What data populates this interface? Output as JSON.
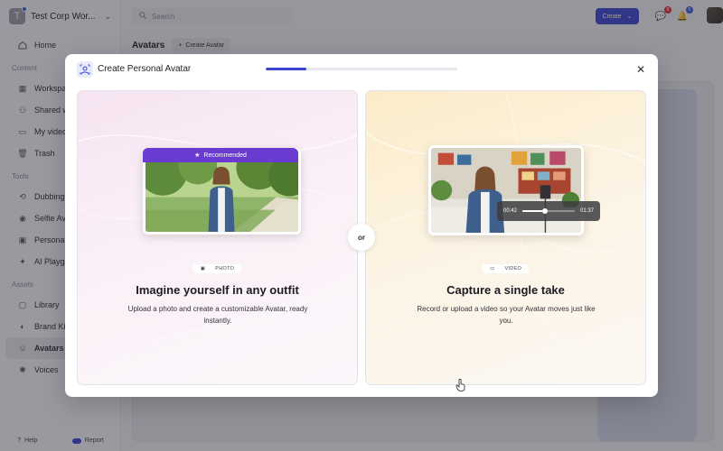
{
  "workspace": {
    "initial": "T",
    "name": "Test Corp Wor..."
  },
  "nav": {
    "home": "Home",
    "content_section": "Content",
    "content_items": [
      "Workspace",
      "Shared with",
      "My videos",
      "Trash"
    ],
    "tools_section": "Tools",
    "tools_items": [
      "Dubbing",
      "Selfie Avata",
      "Personaliza",
      "AI Playgrou"
    ],
    "assets_section": "Assets",
    "assets_items": [
      "Library",
      "Brand Kits",
      "Avatars",
      "Voices"
    ],
    "help": "Help",
    "report": "Report"
  },
  "topbar": {
    "search_placeholder": "Search",
    "create_label": "Create",
    "messages_count": "8",
    "notifications_count": "5"
  },
  "page": {
    "title": "Avatars",
    "create_avatar_label": "Create Avatar"
  },
  "modal": {
    "title": "Create Personal Avatar",
    "progress": 0.21,
    "or_label": "or",
    "photo": {
      "badge": "Recommended",
      "kind": "PHOTO",
      "title": "Imagine yourself in any outfit",
      "desc": "Upload a photo and create a customizable Avatar, ready instantly."
    },
    "video": {
      "kind": "VIDEO",
      "title": "Capture a single take",
      "desc": "Record or upload a video so your Avatar moves just like you.",
      "time_current": "00:42",
      "time_total": "01:37",
      "playback_progress": 0.43
    }
  },
  "colors": {
    "accent": "#3a43cf",
    "recommended": "#6a3bd1",
    "badge_red": "#e03131",
    "badge_blue": "#3b5bdb"
  }
}
